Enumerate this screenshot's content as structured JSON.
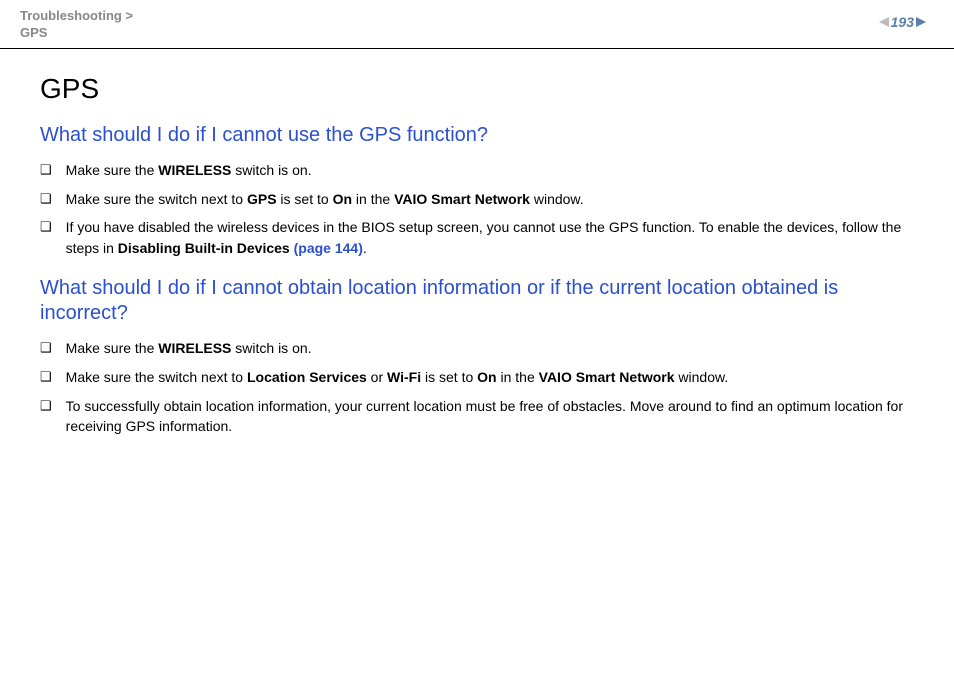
{
  "header": {
    "breadcrumb_line1": "Troubleshooting >",
    "breadcrumb_line2": "GPS",
    "page_number": "193"
  },
  "page_title": "GPS",
  "sections": [
    {
      "heading": "What should I do if I cannot use the GPS function?",
      "items": [
        {
          "runs": [
            {
              "t": "Make sure the "
            },
            {
              "t": "WIRELESS",
              "b": true
            },
            {
              "t": " switch is on."
            }
          ]
        },
        {
          "runs": [
            {
              "t": "Make sure the switch next to "
            },
            {
              "t": "GPS",
              "b": true
            },
            {
              "t": " is set to "
            },
            {
              "t": "On",
              "b": true
            },
            {
              "t": " in the "
            },
            {
              "t": "VAIO Smart Network",
              "b": true
            },
            {
              "t": " window."
            }
          ]
        },
        {
          "runs": [
            {
              "t": "If you have disabled the wireless devices in the BIOS setup screen, you cannot use the GPS function. To enable the devices, follow the steps in "
            },
            {
              "t": "Disabling Built-in Devices ",
              "b": true
            },
            {
              "t": "(page 144)",
              "b": true,
              "link": true
            },
            {
              "t": "."
            }
          ]
        }
      ]
    },
    {
      "heading": "What should I do if I cannot obtain location information or if the current location obtained is incorrect?",
      "items": [
        {
          "runs": [
            {
              "t": "Make sure the "
            },
            {
              "t": "WIRELESS",
              "b": true
            },
            {
              "t": " switch is on."
            }
          ]
        },
        {
          "runs": [
            {
              "t": "Make sure the switch next to "
            },
            {
              "t": "Location Services",
              "b": true
            },
            {
              "t": " or "
            },
            {
              "t": "Wi-Fi",
              "b": true
            },
            {
              "t": " is set to "
            },
            {
              "t": "On",
              "b": true
            },
            {
              "t": " in the "
            },
            {
              "t": "VAIO Smart Network",
              "b": true
            },
            {
              "t": " window."
            }
          ]
        },
        {
          "runs": [
            {
              "t": "To successfully obtain location information, your current location must be free of obstacles. Move around to find an optimum location for receiving GPS information."
            }
          ]
        }
      ]
    }
  ]
}
